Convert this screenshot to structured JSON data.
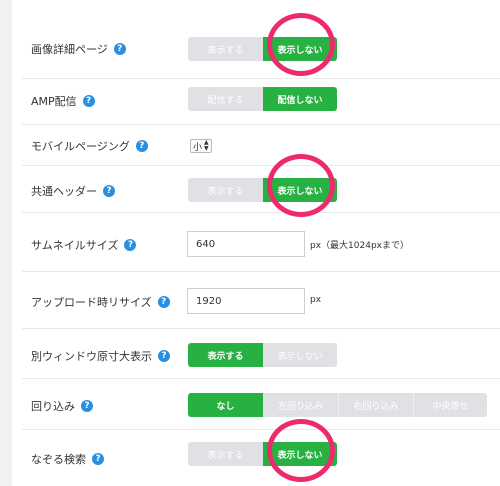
{
  "settings": [
    {
      "label": "画像詳細ページ",
      "options": [
        "表示する",
        "表示しない"
      ],
      "selected": 1
    },
    {
      "label": "AMP配信",
      "options": [
        "配信する",
        "配信しない"
      ],
      "selected": 1
    },
    {
      "label": "モバイルページング",
      "value": "小"
    },
    {
      "label": "共通ヘッダー",
      "options": [
        "表示する",
        "表示しない"
      ],
      "selected": 1
    },
    {
      "label": "サムネイルサイズ",
      "value": "640",
      "unit": "px（最大1024pxまで）"
    },
    {
      "label": "アップロード時リサイズ",
      "value": "1920",
      "unit": "px"
    },
    {
      "label": "別ウィンドウ原寸大表示",
      "options": [
        "表示する",
        "表示しない"
      ],
      "selected": 0
    },
    {
      "label": "回り込み",
      "options": [
        "なし",
        "左回り込み",
        "右回り込み",
        "中央寄せ"
      ],
      "selected": 0
    },
    {
      "label": "なぞる検索",
      "options": [
        "表示する",
        "表示しない"
      ],
      "selected": 1
    }
  ],
  "help_icon": "?",
  "select_arrow_icon": "up-down-arrows",
  "highlight_color": "#ec2a6c",
  "accent_color": "#27b142",
  "help_color": "#2a8fe0"
}
